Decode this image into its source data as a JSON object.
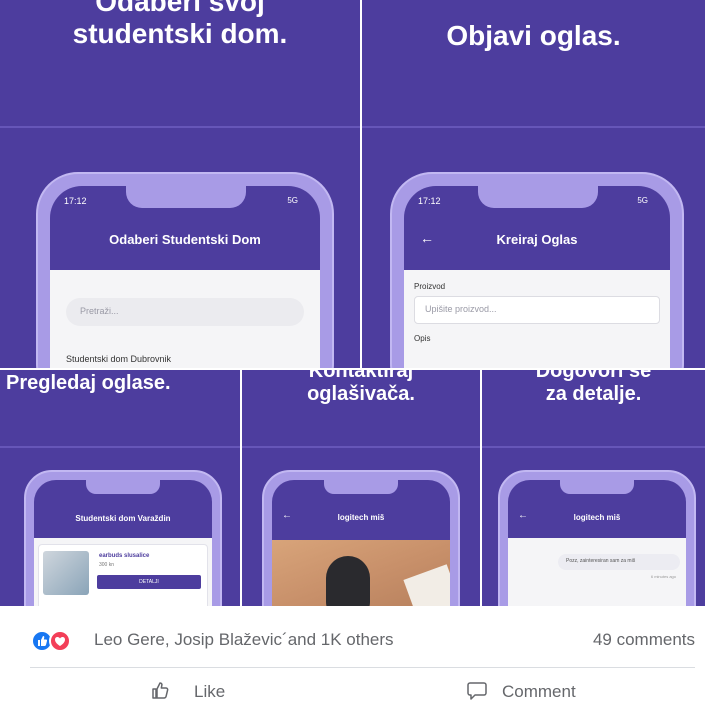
{
  "tiles": {
    "t1": {
      "caption_line1": "Odaberi svoj",
      "caption_line2": "studentski dom.",
      "status_time": "17:12",
      "status_right": "5G",
      "screen_title": "Odaberi Studentski Dom",
      "search_placeholder": "Pretraži...",
      "list_item": "Studentski dom Dubrovnik"
    },
    "t2": {
      "caption": "Objavi oglas.",
      "status_time": "17:12",
      "status_right": "5G",
      "back_arrow": "←",
      "screen_title": "Kreiraj Oglas",
      "field_label": "Proizvod",
      "field_placeholder": "Upišite proizvod...",
      "field2_label": "Opis"
    },
    "t3": {
      "caption": "Pregledaj oglase.",
      "screen_title": "Studentski dom Varaždin",
      "ad_title": "earbuds slusalice",
      "ad_price": "300 kn",
      "ad_button": "DETALJI"
    },
    "t4": {
      "caption_line1": "Kontaktiraj",
      "caption_line2": "oglašivača.",
      "back_arrow": "←",
      "screen_title": "logitech miš"
    },
    "t5": {
      "caption_line1": "Dogovori se",
      "caption_line2": "za detalje.",
      "back_arrow": "←",
      "screen_title": "logitech miš",
      "message": "Pozz, zainteresiran sam za miš",
      "message_time": "6 minutes ago"
    }
  },
  "reactions": {
    "names": "Leo Gere, Josip Blaževic´and 1K others",
    "comments": "49 comments"
  },
  "actions": {
    "like": "Like",
    "comment": "Comment"
  },
  "colors": {
    "purple": "#4d3d9e",
    "phone": "#a89be6",
    "like_blue": "#1877f2",
    "love_red": "#f33e58"
  }
}
